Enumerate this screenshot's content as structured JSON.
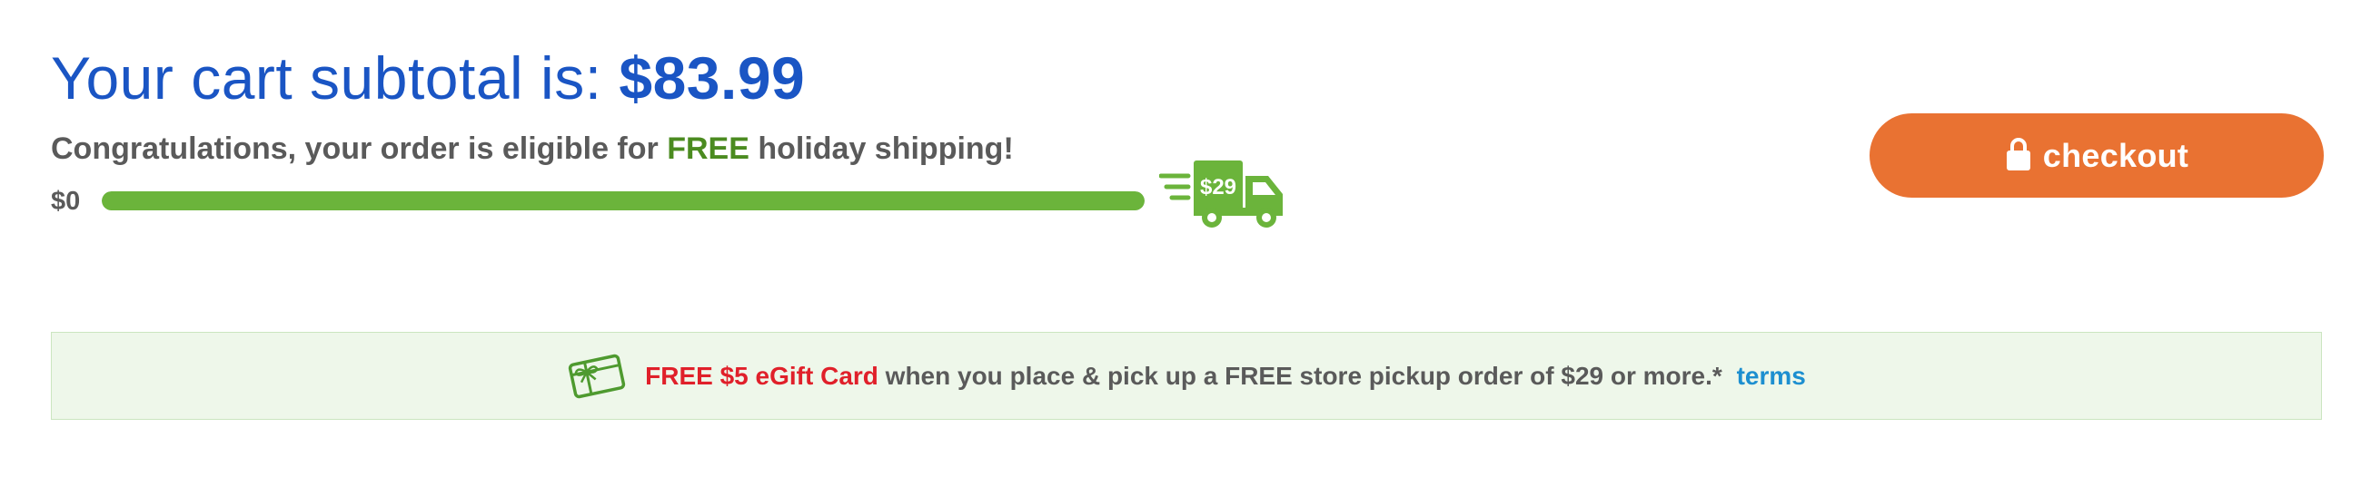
{
  "cart": {
    "subtotal_label": "Your cart subtotal is:",
    "subtotal_amount": "$83.99"
  },
  "shipping": {
    "message_prefix": "Congratulations, your order is eligible for",
    "message_free": "FREE",
    "message_suffix": "holiday shipping!",
    "progress_start_label": "$0",
    "threshold_label": "$29",
    "progress_fraction": 1.0
  },
  "checkout": {
    "label": "checkout",
    "icon": "lock-icon"
  },
  "promo": {
    "icon": "gift-card-icon",
    "highlight": "FREE $5 eGift Card",
    "text": "when you place & pick up a FREE store pickup order of $29 or more.*",
    "terms_label": "terms"
  },
  "colors": {
    "subtotal_blue": "#1a55c4",
    "free_green": "#4b8b20",
    "progress_green": "#6bb43b",
    "checkout_orange": "#e97232",
    "promo_background": "#eef7ea",
    "promo_red": "#e0202a",
    "link_blue": "#1d8fd0"
  }
}
